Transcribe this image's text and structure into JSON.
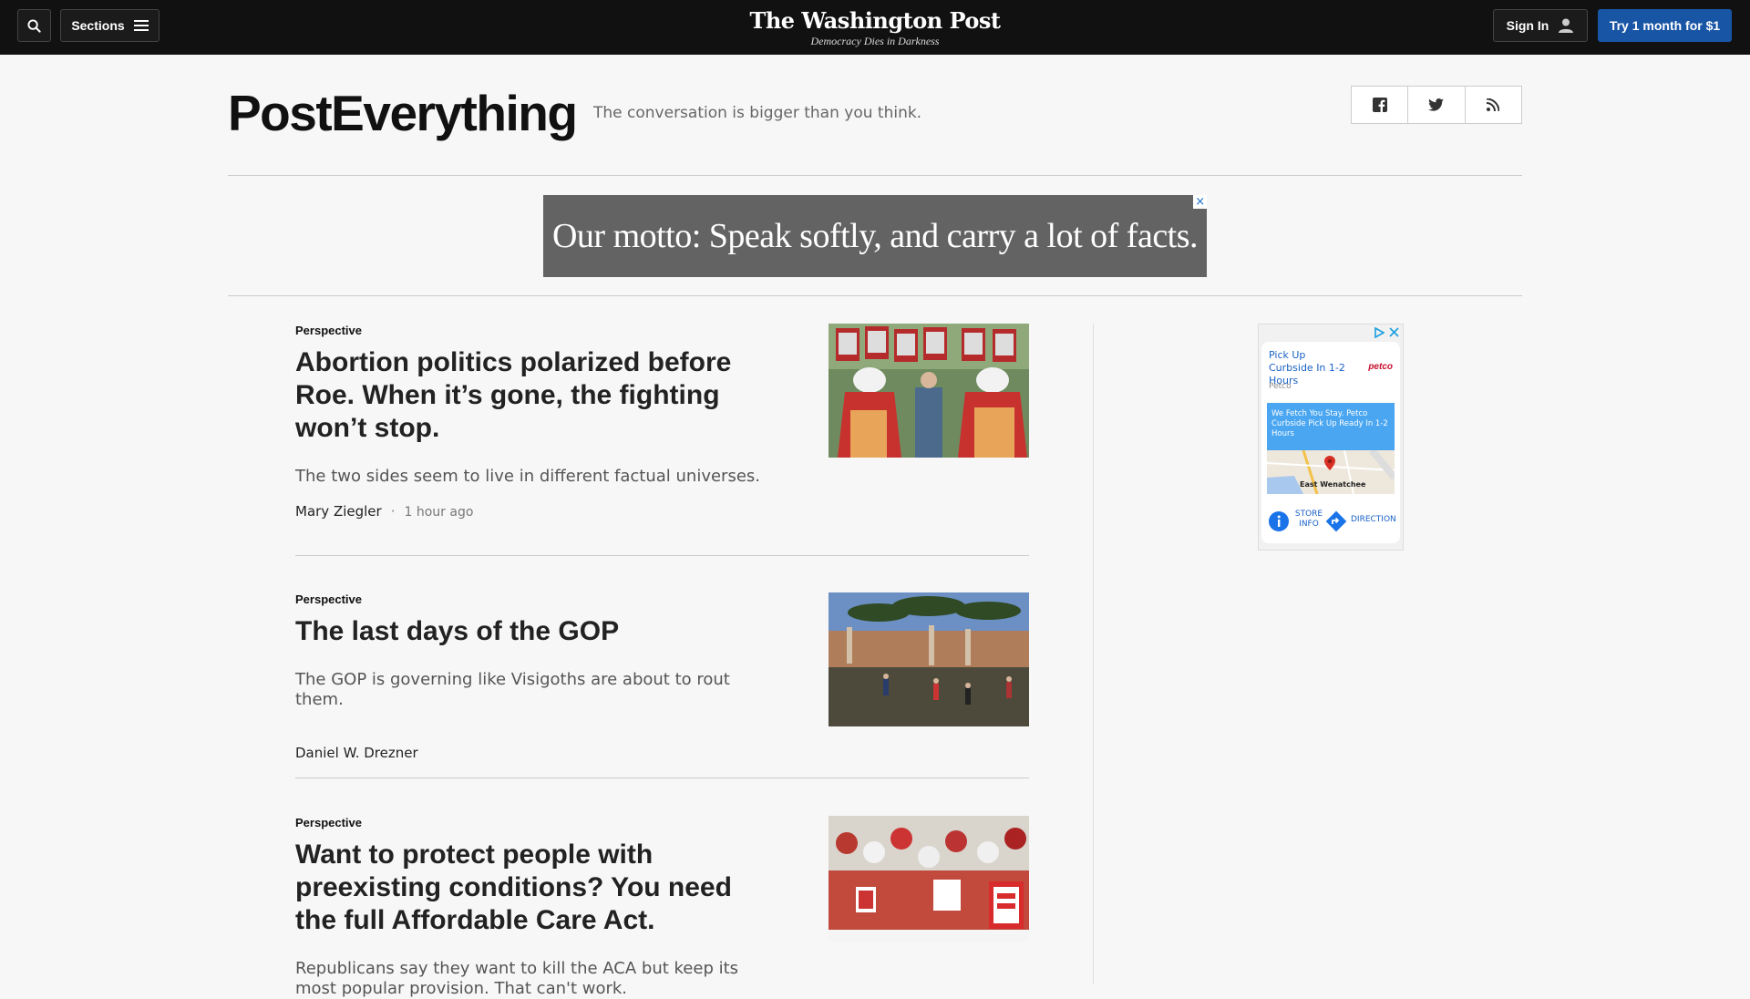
{
  "topbar": {
    "sections_label": "Sections",
    "logo": "The Washington Post",
    "tagline": "Democracy Dies in Darkness",
    "signin_label": "Sign In",
    "try_label": "Try 1 month for $1"
  },
  "section": {
    "title": "PostEverything",
    "subtitle": "The conversation is bigger than you think."
  },
  "ad_banner": {
    "text": "Our motto: Speak softly, and carry a lot of facts."
  },
  "articles": [
    {
      "kicker": "Perspective",
      "headline": "Abortion politics polarized before Roe. When it’s gone, the fighting won’t stop.",
      "dek": "The two sides seem to live in different factual universes.",
      "author": "Mary Ziegler",
      "timestamp": "1 hour ago"
    },
    {
      "kicker": "Perspective",
      "headline": "The last days of the GOP",
      "dek": "The GOP is governing like Visigoths are about to rout them.",
      "author": "Daniel W. Drezner",
      "timestamp": ""
    },
    {
      "kicker": "Perspective",
      "headline": "Want to protect people with preexisting conditions? You need the full Affordable Care Act.",
      "dek": "Republicans say they want to kill the ACA but keep its most popular provision. That can't work.",
      "author": "",
      "timestamp": ""
    }
  ],
  "side_ad": {
    "title": "Pick Up Curbside In 1-2 Hours",
    "brand": "petco",
    "advertiser": "Petco",
    "blurb": "We Fetch You Stay. Petco Curbside Pick Up Ready In 1-2 Hours",
    "map_label": "East Wenatchee",
    "store_info": "STORE INFO",
    "directions": "DIRECTION"
  },
  "images": {
    "article1": "Protesters in red cloaks and white bonnets holding Trump Pence OUT signs",
    "article2": "Roman ruins with umbrella pine trees and people walking",
    "article3": "Crowd of protesters holding SAVE OUR HEALTHCARE signs"
  },
  "colors": {
    "topbar_bg": "#111111",
    "try_button": "#1955a5",
    "page_bg": "#f7f7f7"
  }
}
